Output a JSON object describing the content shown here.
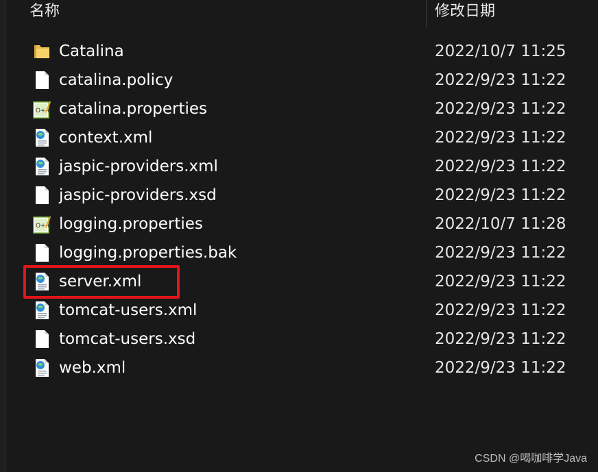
{
  "columns": {
    "name": "名称",
    "modified": "修改日期"
  },
  "files": [
    {
      "name": "Catalina",
      "modified": "2022/10/7 11:25",
      "icon": "folder-icon"
    },
    {
      "name": "catalina.policy",
      "modified": "2022/9/23 11:22",
      "icon": "blank-file-icon"
    },
    {
      "name": "catalina.properties",
      "modified": "2022/9/23 11:22",
      "icon": "properties-file-icon"
    },
    {
      "name": "context.xml",
      "modified": "2022/9/23 11:22",
      "icon": "xml-file-icon"
    },
    {
      "name": "jaspic-providers.xml",
      "modified": "2022/9/23 11:22",
      "icon": "xml-file-icon"
    },
    {
      "name": "jaspic-providers.xsd",
      "modified": "2022/9/23 11:22",
      "icon": "blank-file-icon"
    },
    {
      "name": "logging.properties",
      "modified": "2022/10/7 11:28",
      "icon": "properties-file-icon"
    },
    {
      "name": "logging.properties.bak",
      "modified": "2022/9/23 11:22",
      "icon": "blank-file-icon"
    },
    {
      "name": "server.xml",
      "modified": "2022/9/23 11:22",
      "icon": "xml-file-icon"
    },
    {
      "name": "tomcat-users.xml",
      "modified": "2022/9/23 11:22",
      "icon": "xml-file-icon"
    },
    {
      "name": "tomcat-users.xsd",
      "modified": "2022/9/23 11:22",
      "icon": "blank-file-icon"
    },
    {
      "name": "web.xml",
      "modified": "2022/9/23 11:22",
      "icon": "xml-file-icon"
    }
  ],
  "highlight_color": "#e3141a",
  "watermark": "CSDN @喝咖啡学Java"
}
